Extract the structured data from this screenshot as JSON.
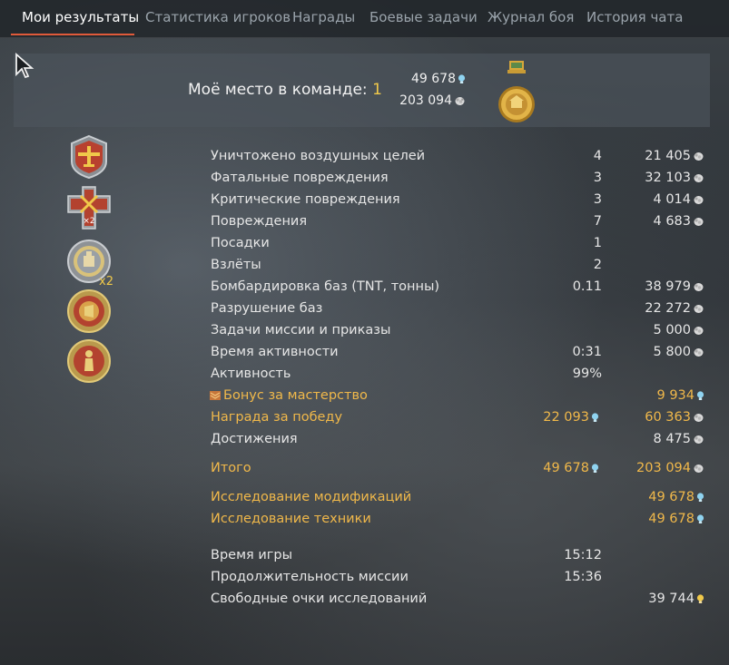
{
  "tabs": [
    {
      "label": "Мои результаты",
      "active": true
    },
    {
      "label": "Статистика игроков"
    },
    {
      "label": "Награды"
    },
    {
      "label": "Боевые задачи"
    },
    {
      "label": "Журнал боя"
    },
    {
      "label": "История чата"
    }
  ],
  "banner": {
    "place_label": "Моё место в команде:",
    "place_value": "1",
    "rp": "49 678",
    "sl": "203 094"
  },
  "award_multiplier": "x2",
  "rows": [
    {
      "label": "Уничтожено воздушных целей",
      "count": "4",
      "sl": "21 405"
    },
    {
      "label": "Фатальные повреждения",
      "count": "3",
      "sl": "32 103"
    },
    {
      "label": "Критические повреждения",
      "count": "3",
      "sl": "4 014"
    },
    {
      "label": "Повреждения",
      "count": "7",
      "sl": "4 683"
    },
    {
      "label": "Посадки",
      "count": "1"
    },
    {
      "label": "Взлёты",
      "count": "2"
    },
    {
      "label": "Бомбардировка баз (TNT, тонны)",
      "count": "0.11",
      "sl": "38 979"
    },
    {
      "label": "Разрушение баз",
      "sl": "22 272"
    },
    {
      "label": "Задачи миссии и приказы",
      "sl": "5 000"
    },
    {
      "label": "Время активности",
      "count": "0:31",
      "sl": "5 800"
    },
    {
      "label": "Активность",
      "count": "99%"
    },
    {
      "label": "Бонус за мастерство",
      "rp": "9 934"
    },
    {
      "label": "Награда за победу",
      "count_rp": "22 093",
      "sl": "60 363"
    },
    {
      "label": "Достижения",
      "sl": "8 475"
    },
    {
      "label": "Итого",
      "count_rp": "49 678",
      "sl": "203 094"
    },
    {
      "label": "Исследование модификаций",
      "rp": "49 678"
    },
    {
      "label": "Исследование техники",
      "rp": "49 678"
    },
    {
      "label": "Время игры",
      "count": "15:12"
    },
    {
      "label": "Продолжительность миссии",
      "count": "15:36"
    },
    {
      "label": "Свободные очки исследований",
      "frp": "39 744"
    }
  ],
  "colors": {
    "accent": "#e05a3a",
    "gold": "#f0b84a",
    "rp_icon": "#8fd3f0",
    "frp_icon": "#f0c94a"
  },
  "icons": {
    "rp": "research-bulb-icon",
    "sl": "silver-lions-icon",
    "frp": "free-research-bulb-icon"
  }
}
